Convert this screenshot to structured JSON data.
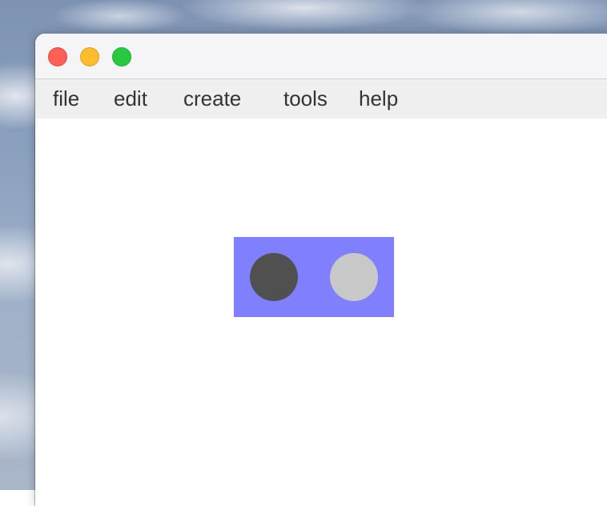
{
  "window": {
    "controls": {
      "close": "close-button",
      "minimize": "minimize-button",
      "zoom": "zoom-button"
    }
  },
  "menu": {
    "items": [
      {
        "label": "file"
      },
      {
        "label": "edit"
      },
      {
        "label": "create"
      },
      {
        "label": "tools"
      },
      {
        "label": "help"
      }
    ]
  },
  "canvas": {
    "widget": {
      "fill": "#8080ff",
      "circles": [
        {
          "color": "#505050"
        },
        {
          "color": "#c8c8c8"
        }
      ]
    }
  },
  "colors": {
    "close": "#fe5f57",
    "minimize": "#febc2e",
    "zoom": "#28c840",
    "menubar": "#efefef",
    "titlebar": "#f5f5f7"
  }
}
